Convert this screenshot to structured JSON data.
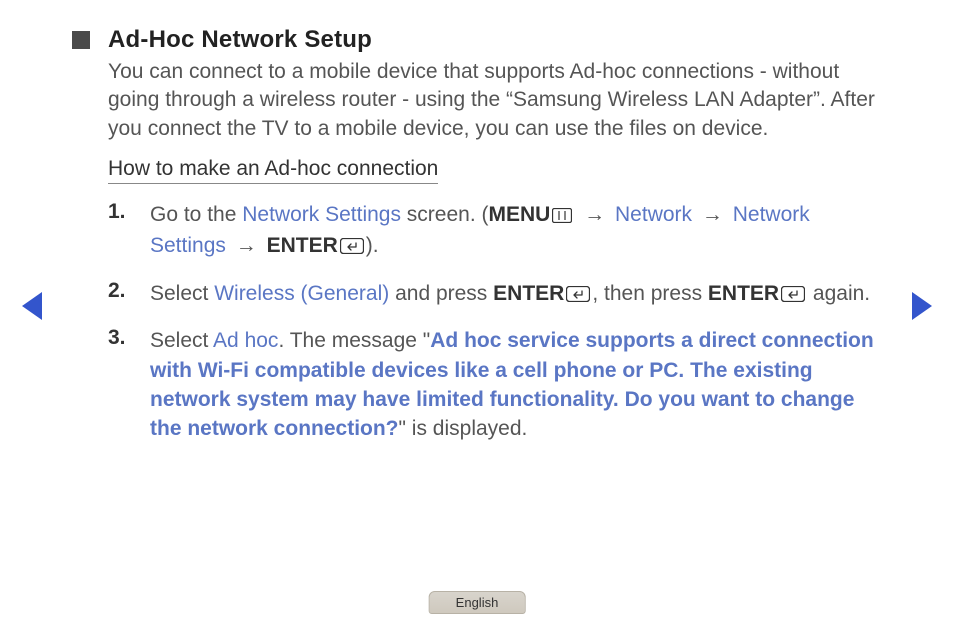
{
  "title": "Ad-Hoc Network Setup",
  "intro": "You can connect to a mobile device that supports Ad-hoc connections - without going through a wireless router - using the “Samsung Wireless LAN Adapter”. After you connect the TV to a mobile device, you can use the files on device.",
  "subhead": "How to make an Ad-hoc connection",
  "steps": {
    "s1": {
      "num": "1.",
      "t1": "Go to the ",
      "link1": "Network Settings",
      "t2": " screen. (",
      "menu": "MENU",
      "arrow": " → ",
      "net": "Network",
      "netset": "Network Settings",
      "enter": "ENTER",
      "t3": ")."
    },
    "s2": {
      "num": "2.",
      "t1": "Select ",
      "link1": "Wireless (General)",
      "t2": " and press ",
      "enter": "ENTER",
      "t3": ", then press ",
      "t4": " again."
    },
    "s3": {
      "num": "3.",
      "t1": "Select ",
      "link1": "Ad hoc",
      "t2": ". The message \"",
      "msg": "Ad hoc service supports a direct connection with Wi-Fi compatible devices like a cell phone or PC. The existing network system may have limited functionality. Do you want to change the network connection?",
      "t3": "\" is displayed."
    }
  },
  "lang": "English"
}
